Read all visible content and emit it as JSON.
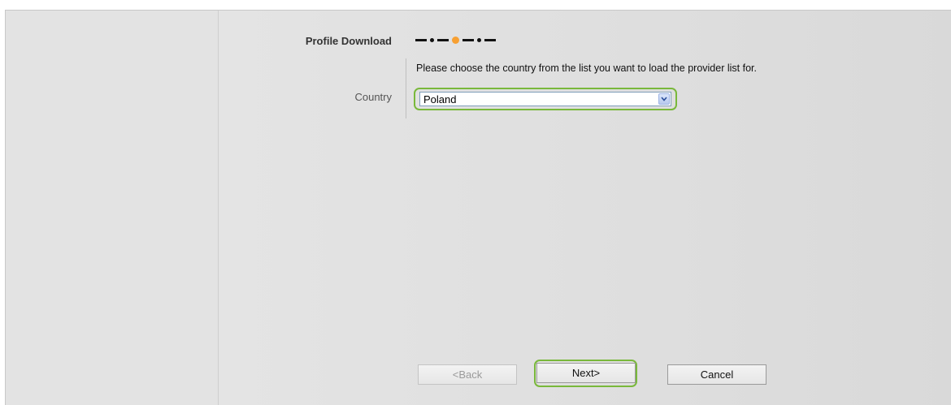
{
  "wizard": {
    "step_title": "Profile Download",
    "progress": {
      "total_steps": 4,
      "current_step": 3
    },
    "instruction": "Please choose the country from the list you want to load the provider list for."
  },
  "form": {
    "country_label": "Country",
    "country_value": "Poland"
  },
  "buttons": {
    "back": "<Back",
    "next": "Next>",
    "cancel": "Cancel"
  },
  "colors": {
    "highlight": "#79b83b",
    "active_step": "#f7a032"
  },
  "icons": {
    "dropdown": "chevron-down-icon"
  }
}
